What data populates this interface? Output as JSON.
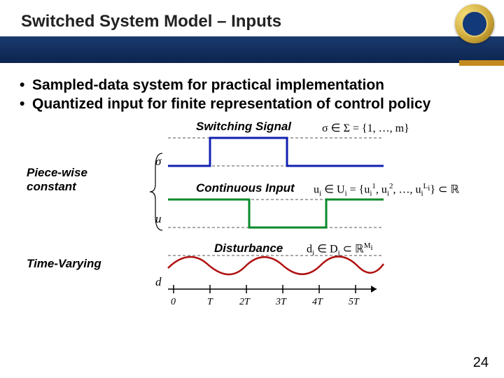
{
  "header": {
    "title": "Switched System Model – Inputs"
  },
  "bullets": [
    "Sampled-data system for practical implementation",
    "Quantized input for finite representation of control policy"
  ],
  "labels": {
    "switching": "Switching Signal",
    "continuous": "Continuous Input",
    "disturbance": "Disturbance",
    "piecewise": "Piece-wise constant",
    "timevarying": "Time-Varying"
  },
  "math": {
    "sigma_set": "σ ∈ Σ = {1, …, m}",
    "u_set_html": "u<span class='sub'>i</span> ∈ U<span class='sub'>i</span> = {u<span class='sub'>i</span><span class='sup'>1</span>, u<span class='sub'>i</span><span class='sup'>2</span>, …, u<span class='sub'>i</span><span class='sup'>L<span class='sub'>i</span></span>} ⊂ ℝ",
    "d_set_html": "d<span class='sub'>i</span> ∈ D<span class='sub'>i</span> ⊂ ℝ<span class='sup'>M<span class='sub'>i</span></span>"
  },
  "axis": {
    "ticks": [
      "0",
      "T",
      "2T",
      "3T",
      "4T",
      "5T"
    ],
    "sigma": "σ",
    "u": "u",
    "d": "d"
  },
  "page": "24"
}
